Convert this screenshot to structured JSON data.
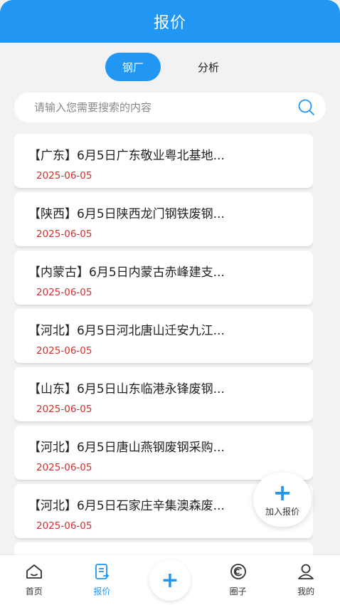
{
  "header": {
    "title": "报价"
  },
  "tabs": [
    {
      "label": "钢厂",
      "active": true
    },
    {
      "label": "分析",
      "active": false
    }
  ],
  "search": {
    "placeholder": "请输入您需要搜索的内容",
    "icon": "search-icon"
  },
  "items": [
    {
      "title": "【广东】6月5日广东敬业粤北基地...",
      "date": "2025-06-05"
    },
    {
      "title": "【陕西】6月5日陕西龙门钢铁废钢...",
      "date": "2025-06-05"
    },
    {
      "title": "【内蒙古】6月5日内蒙古赤峰建支...",
      "date": "2025-06-05"
    },
    {
      "title": "【河北】6月5日河北唐山迁安九江...",
      "date": "2025-06-05"
    },
    {
      "title": "【山东】6月5日山东临港永锋废钢...",
      "date": "2025-06-05"
    },
    {
      "title": "【河北】6月5日唐山燕钢废钢采购...",
      "date": "2025-06-05"
    },
    {
      "title": "【河北】6月5日石家庄辛集澳森废...",
      "date": "2025-06-05"
    }
  ],
  "fab": {
    "icon": "plus-icon",
    "label": "加入报价"
  },
  "tabbar": {
    "home": {
      "label": "首页",
      "icon": "home-icon"
    },
    "quote": {
      "label": "报价",
      "icon": "quote-doc-icon",
      "active": true
    },
    "center": {
      "icon": "plus-icon"
    },
    "circle": {
      "label": "圈子",
      "icon": "circle-icon"
    },
    "mine": {
      "label": "我的",
      "icon": "user-icon"
    }
  },
  "colors": {
    "primary": "#2196f3",
    "date": "#d32f2f",
    "background": "#f2f2f2"
  }
}
